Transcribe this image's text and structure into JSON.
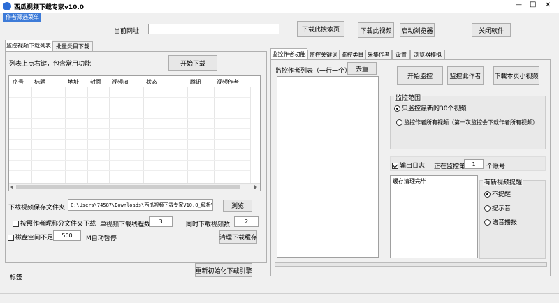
{
  "window": {
    "title": "西瓜视频下载专家v10.0",
    "minimize": "—",
    "maximize": "□",
    "close": "✕"
  },
  "menu": {
    "item": "作者筛选菜单"
  },
  "top": {
    "url_label": "当前网址:",
    "url_value": "",
    "download_search": "下载此搜索页",
    "download_video": "下载此视频",
    "start_browser": "启动浏览器",
    "close_software": "关闭软件"
  },
  "left": {
    "tabs": [
      "监控视频下载列表",
      "批量类目下载"
    ],
    "hint": "列表上点右键，包含常用功能",
    "start_download": "开始下载",
    "columns": [
      "序号",
      "标题",
      "地址",
      "封面",
      "视频id",
      "状态",
      "腾讯",
      "视频作者"
    ],
    "save_folder_label": "下载视频保存文件夹",
    "save_folder_value": "C:\\Users\\74587\\Downloads\\西瓜视频下载专家V10.0_解析\\do",
    "browse": "浏览",
    "by_author_folder": "按照作者昵称分文件夹下载",
    "single_threads_label": "单视频下载线程数:",
    "single_threads_value": "3",
    "concurrent_label": "同时下载视频数:",
    "concurrent_value": "2",
    "disk_low_label": "磁盘空间不足",
    "disk_low_value": "500",
    "disk_low_suffix": "M自动暂停",
    "clear_cache": "清理下载缓存",
    "reinit": "重新初始化下载引擎",
    "status_label": "标签"
  },
  "right": {
    "tabs": [
      "监控作者功能",
      "监控关键词",
      "监控类目",
      "采集作者",
      "设置",
      "浏览器模拟"
    ],
    "author_list_label": "监控作者列表（一行一个）",
    "dedupe": "去重",
    "start_monitor": "开始监控",
    "monitor_this_author": "监控此作者",
    "download_page_small": "下载本页小视频",
    "range_title": "监控范围",
    "range_opt1": "只监控最新的30个视频",
    "range_opt2": "监控作者所有视频（第一次监控会下载作者所有视频）",
    "output_log": "输出日志",
    "monitoring_prefix": "正在监控第",
    "monitoring_value": "1",
    "monitoring_suffix": "个账号",
    "log_text": "缓存清理完毕",
    "notify_title": "有新视频提醒",
    "notify_opt1": "不提醒",
    "notify_opt2": "提示音",
    "notify_opt3": "语音播报"
  }
}
